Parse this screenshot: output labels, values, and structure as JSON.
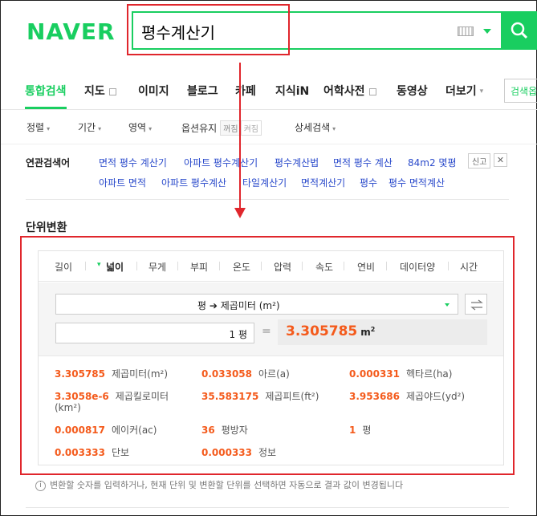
{
  "logo": "NAVER",
  "search": {
    "value": "평수계산기"
  },
  "tabs": [
    {
      "label": "통합검색"
    },
    {
      "label": "지도"
    },
    {
      "label": "이미지"
    },
    {
      "label": "블로그"
    },
    {
      "label": "카페"
    },
    {
      "label": "지식iN"
    },
    {
      "label": "어학사전"
    },
    {
      "label": "동영상"
    },
    {
      "label": "더보기"
    }
  ],
  "more_button": "검색옵",
  "options": {
    "sort": "정렬",
    "period": "기간",
    "area": "영역",
    "keep_label": "옵션유지",
    "keep_on": "꺼짐",
    "keep_off": "켜짐",
    "detail": "상세검색"
  },
  "related": {
    "title": "연관검색어",
    "items": [
      "면적 평수 계산기",
      "아파트 평수계산기",
      "평수계산법",
      "면적 평수 계산",
      "84m2 몇평",
      "아파트 면적",
      "아파트 평수계산",
      "타일계산기",
      "면적계산기",
      "평수",
      "평수 면적계산"
    ],
    "report": "신고",
    "close": "✕"
  },
  "section_title": "단위변환",
  "unit_tabs": [
    "길이",
    "넓이",
    "무게",
    "부피",
    "온도",
    "압력",
    "속도",
    "연비",
    "데이터양",
    "시간"
  ],
  "active_unit_tab": "넓이",
  "conversion": {
    "from": "평",
    "arrow": "➔",
    "to": "제곱미터 (m²)",
    "input_value": "1",
    "input_unit": "평",
    "equals": "=",
    "result_value": "3.305785",
    "result_unit": "m",
    "result_unit_sup": "2"
  },
  "results": [
    {
      "value": "3.305785",
      "unit": "제곱미터(m²)"
    },
    {
      "value": "0.033058",
      "unit": "아르(a)"
    },
    {
      "value": "0.000331",
      "unit": "헥타르(ha)"
    },
    {
      "value": "3.3058e-6",
      "unit": "제곱킬로미터"
    },
    {
      "value": "35.583175",
      "unit": "제곱피트(ft²)"
    },
    {
      "value": "3.953686",
      "unit": "제곱야드(yd²)"
    },
    {
      "value": "0.000817",
      "unit": "에이커(ac)"
    },
    {
      "value": "36",
      "unit": "평방자"
    },
    {
      "value": "1",
      "unit": "평"
    },
    {
      "value": "0.003333",
      "unit": "단보"
    },
    {
      "value": "0.000333",
      "unit": "정보"
    }
  ],
  "result_extra_line": "(km²)",
  "footnote": "변환할 숫자를 입력하거나, 현재 단위 및 변환할 단위를 선택하면 자동으로 결과 값이 변경됩니다",
  "colors": {
    "brand": "#19ce60",
    "annotation": "#e0262c",
    "result": "#f45a1b"
  }
}
